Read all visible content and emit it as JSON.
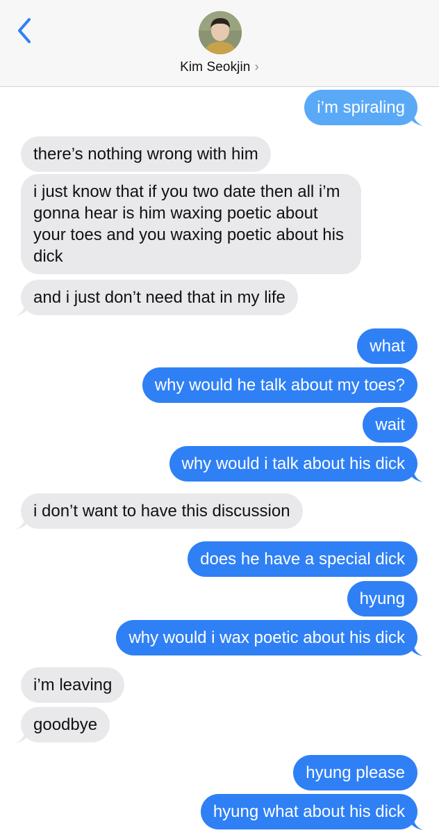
{
  "header": {
    "contact_name": "Kim Seokjin",
    "chevron": "›",
    "back_icon": "chevron-left-icon"
  },
  "colors": {
    "incoming": "#e9e9eb",
    "outgoing_dark": "#2f80f5",
    "outgoing_light": "#5aa9f7",
    "back_arrow": "#2f80f5"
  },
  "messages": [
    {
      "side": "out",
      "text": "i’m spiraling"
    },
    {
      "side": "in",
      "text": "there’s nothing wrong with him"
    },
    {
      "side": "in",
      "text": "i just know that if you two date then all i’m gonna hear is him waxing poetic about your toes and you waxing poetic about his dick"
    },
    {
      "side": "in",
      "text": "and i just don’t need that in my life"
    },
    {
      "side": "out",
      "text": "what"
    },
    {
      "side": "out",
      "text": "why would he talk about my toes?"
    },
    {
      "side": "out",
      "text": "wait"
    },
    {
      "side": "out",
      "text": "why would i talk about his dick"
    },
    {
      "side": "in",
      "text": "i don’t want to have this discussion"
    },
    {
      "side": "out",
      "text": "does he have a special dick"
    },
    {
      "side": "out",
      "text": "hyung"
    },
    {
      "side": "out",
      "text": "why would i wax poetic about his dick"
    },
    {
      "side": "in",
      "text": "i’m leaving"
    },
    {
      "side": "in",
      "text": "goodbye"
    },
    {
      "side": "out",
      "text": "hyung please"
    },
    {
      "side": "out",
      "text": "hyung what about his dick"
    }
  ]
}
